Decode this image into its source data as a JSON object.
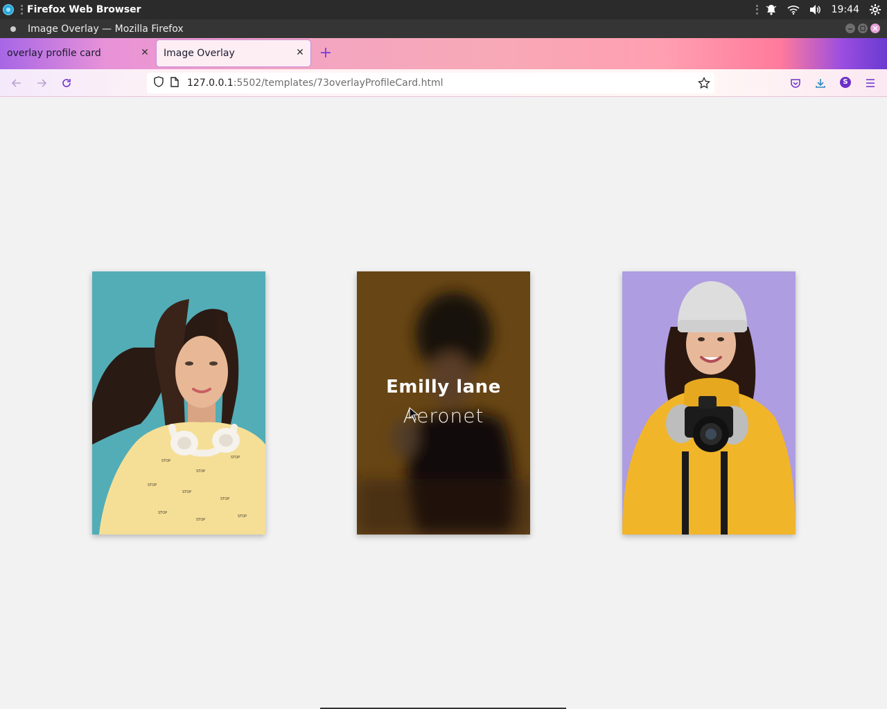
{
  "system_bar": {
    "app_name": "Firefox Web Browser",
    "clock": "19:44"
  },
  "window": {
    "title": "Image Overlay — Mozilla Firefox"
  },
  "tabs": [
    {
      "label": "overlay profile card",
      "active": false
    },
    {
      "label": "Image Overlay",
      "active": true
    }
  ],
  "address_bar": {
    "host": "127.0.0.1",
    "rest": ":5502/templates/73overlayProfileCard.html"
  },
  "account": {
    "initial": "S"
  },
  "cards": [
    {
      "id": "card-1",
      "subject": "woman with headphones on teal background"
    },
    {
      "id": "card-2",
      "subject": "blurred portrait with overlay",
      "name": "Emilly lane",
      "role": "Aeronet"
    },
    {
      "id": "card-3",
      "subject": "woman in knit hat holding camera on lavender background"
    }
  ],
  "colors": {
    "accent": "#7b3fd9",
    "card1_bg": "#4aa9b4",
    "card2_bg": "#6b4616",
    "card3_bg": "#a894de"
  }
}
